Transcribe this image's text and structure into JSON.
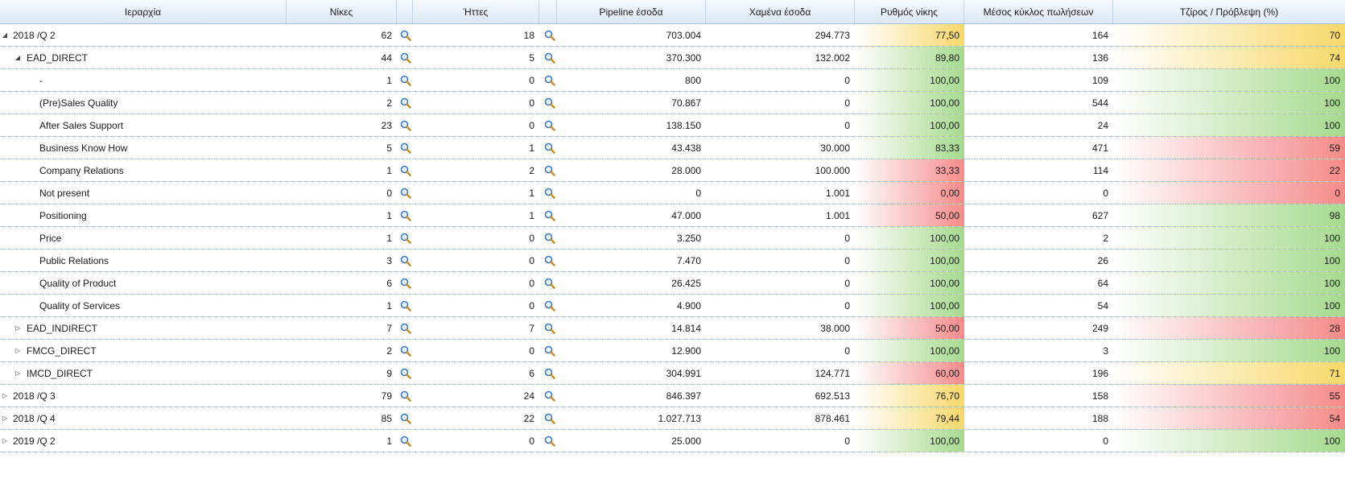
{
  "colors": {
    "high": "#a6da8e",
    "mid": "#f7d86a",
    "low": "#f58b8b",
    "header_top": "#f5f9fd",
    "header_bottom": "#dce8f5"
  },
  "icons": {
    "expanded": "expanded-triangle-icon",
    "collapsed": "collapsed-triangle-icon",
    "drilldown": "magnifier-icon"
  },
  "headers": {
    "hierarchy": "Ιεραρχία",
    "wins": "Νίκες",
    "losses": "Ήττες",
    "pipeline": "Pipeline έσοδα",
    "lost": "Χαμένα έσοδα",
    "win_rate": "Ρυθμός νίκης",
    "avg_cycle": "Μέσος κύκλος πωλήσεων",
    "turnover": "Τζίρος / Πρόβλεψη (%)"
  },
  "rows": [
    {
      "label": "2018 /Q 2",
      "level": 0,
      "expander": "expanded",
      "wins": "62",
      "losses": "18",
      "pipeline": "703.004",
      "lost": "294.773",
      "win_rate": "77,50",
      "win_rate_level": "mid",
      "cycle": "164",
      "turnover": "70",
      "turnover_level": "mid"
    },
    {
      "label": "EAD_DIRECT",
      "level": 1,
      "expander": "expanded",
      "wins": "44",
      "losses": "5",
      "pipeline": "370.300",
      "lost": "132.002",
      "win_rate": "89,80",
      "win_rate_level": "high",
      "cycle": "136",
      "turnover": "74",
      "turnover_level": "mid"
    },
    {
      "label": "-",
      "level": 2,
      "expander": "none",
      "wins": "1",
      "losses": "0",
      "pipeline": "800",
      "lost": "0",
      "win_rate": "100,00",
      "win_rate_level": "high",
      "cycle": "109",
      "turnover": "100",
      "turnover_level": "high"
    },
    {
      "label": "(Pre)Sales Quality",
      "level": 2,
      "expander": "none",
      "wins": "2",
      "losses": "0",
      "pipeline": "70.867",
      "lost": "0",
      "win_rate": "100,00",
      "win_rate_level": "high",
      "cycle": "544",
      "turnover": "100",
      "turnover_level": "high"
    },
    {
      "label": "After Sales Support",
      "level": 2,
      "expander": "none",
      "wins": "23",
      "losses": "0",
      "pipeline": "138.150",
      "lost": "0",
      "win_rate": "100,00",
      "win_rate_level": "high",
      "cycle": "24",
      "turnover": "100",
      "turnover_level": "high"
    },
    {
      "label": "Business Know How",
      "level": 2,
      "expander": "none",
      "wins": "5",
      "losses": "1",
      "pipeline": "43.438",
      "lost": "30.000",
      "win_rate": "83,33",
      "win_rate_level": "high",
      "cycle": "471",
      "turnover": "59",
      "turnover_level": "low"
    },
    {
      "label": "Company Relations",
      "level": 2,
      "expander": "none",
      "wins": "1",
      "losses": "2",
      "pipeline": "28.000",
      "lost": "100.000",
      "win_rate": "33,33",
      "win_rate_level": "low",
      "cycle": "114",
      "turnover": "22",
      "turnover_level": "low"
    },
    {
      "label": "Not present",
      "level": 2,
      "expander": "none",
      "wins": "0",
      "losses": "1",
      "pipeline": "0",
      "lost": "1.001",
      "win_rate": "0,00",
      "win_rate_level": "low",
      "cycle": "0",
      "turnover": "0",
      "turnover_level": "low"
    },
    {
      "label": "Positioning",
      "level": 2,
      "expander": "none",
      "wins": "1",
      "losses": "1",
      "pipeline": "47.000",
      "lost": "1.001",
      "win_rate": "50,00",
      "win_rate_level": "low",
      "cycle": "627",
      "turnover": "98",
      "turnover_level": "high"
    },
    {
      "label": "Price",
      "level": 2,
      "expander": "none",
      "wins": "1",
      "losses": "0",
      "pipeline": "3.250",
      "lost": "0",
      "win_rate": "100,00",
      "win_rate_level": "high",
      "cycle": "2",
      "turnover": "100",
      "turnover_level": "high"
    },
    {
      "label": "Public Relations",
      "level": 2,
      "expander": "none",
      "wins": "3",
      "losses": "0",
      "pipeline": "7.470",
      "lost": "0",
      "win_rate": "100,00",
      "win_rate_level": "high",
      "cycle": "26",
      "turnover": "100",
      "turnover_level": "high"
    },
    {
      "label": "Quality of Product",
      "level": 2,
      "expander": "none",
      "wins": "6",
      "losses": "0",
      "pipeline": "26.425",
      "lost": "0",
      "win_rate": "100,00",
      "win_rate_level": "high",
      "cycle": "64",
      "turnover": "100",
      "turnover_level": "high"
    },
    {
      "label": "Quality of Services",
      "level": 2,
      "expander": "none",
      "wins": "1",
      "losses": "0",
      "pipeline": "4.900",
      "lost": "0",
      "win_rate": "100,00",
      "win_rate_level": "high",
      "cycle": "54",
      "turnover": "100",
      "turnover_level": "high"
    },
    {
      "label": "EAD_INDIRECT",
      "level": 1,
      "expander": "collapsed",
      "wins": "7",
      "losses": "7",
      "pipeline": "14.814",
      "lost": "38.000",
      "win_rate": "50,00",
      "win_rate_level": "low",
      "cycle": "249",
      "turnover": "28",
      "turnover_level": "low"
    },
    {
      "label": "FMCG_DIRECT",
      "level": 1,
      "expander": "collapsed",
      "wins": "2",
      "losses": "0",
      "pipeline": "12.900",
      "lost": "0",
      "win_rate": "100,00",
      "win_rate_level": "high",
      "cycle": "3",
      "turnover": "100",
      "turnover_level": "high"
    },
    {
      "label": "IMCD_DIRECT",
      "level": 1,
      "expander": "collapsed",
      "wins": "9",
      "losses": "6",
      "pipeline": "304.991",
      "lost": "124.771",
      "win_rate": "60,00",
      "win_rate_level": "low",
      "cycle": "196",
      "turnover": "71",
      "turnover_level": "mid"
    },
    {
      "label": "2018 /Q 3",
      "level": 0,
      "expander": "collapsed",
      "wins": "79",
      "losses": "24",
      "pipeline": "846.397",
      "lost": "692.513",
      "win_rate": "76,70",
      "win_rate_level": "mid",
      "cycle": "158",
      "turnover": "55",
      "turnover_level": "low"
    },
    {
      "label": "2018 /Q 4",
      "level": 0,
      "expander": "collapsed",
      "wins": "85",
      "losses": "22",
      "pipeline": "1.027.713",
      "lost": "878.461",
      "win_rate": "79,44",
      "win_rate_level": "mid",
      "cycle": "188",
      "turnover": "54",
      "turnover_level": "low"
    },
    {
      "label": "2019 /Q 2",
      "level": 0,
      "expander": "collapsed",
      "wins": "1",
      "losses": "0",
      "pipeline": "25.000",
      "lost": "0",
      "win_rate": "100,00",
      "win_rate_level": "high",
      "cycle": "0",
      "turnover": "100",
      "turnover_level": "high"
    }
  ]
}
